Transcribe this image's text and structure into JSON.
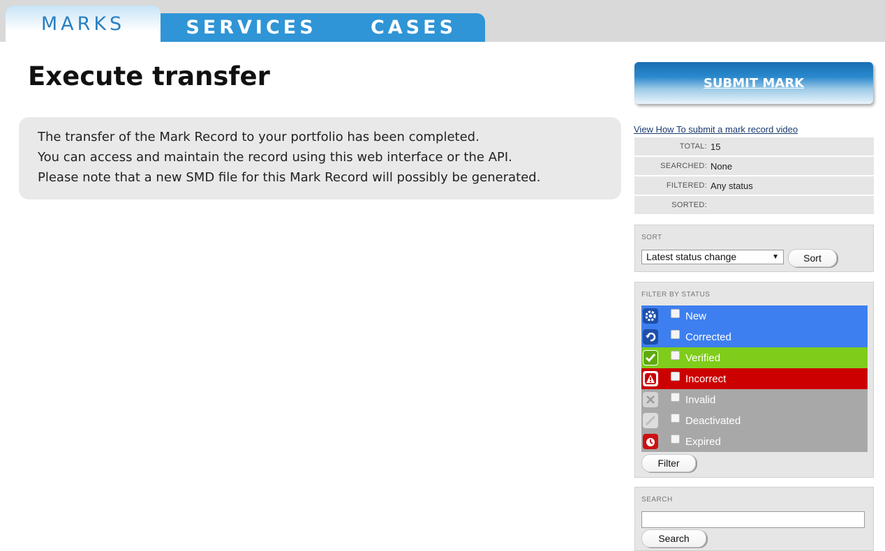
{
  "tabs": [
    {
      "label": "MARKS"
    },
    {
      "label": "SERVICES"
    },
    {
      "label": "CASES"
    }
  ],
  "page": {
    "title": "Execute transfer",
    "message_lines": [
      "The transfer of the Mark Record to your portfolio has been completed.",
      "You can access and maintain the record using this web interface or the API.",
      "Please note that a new SMD file for this Mark Record will possibly be generated."
    ]
  },
  "sidebar": {
    "submit_label": "SUBMIT MARK",
    "video_link": "View How To submit a mark record video",
    "stats": [
      {
        "label": "TOTAL:",
        "value": "15"
      },
      {
        "label": "SEARCHED:",
        "value": "None"
      },
      {
        "label": "FILTERED:",
        "value": "Any status"
      },
      {
        "label": "SORTED:",
        "value": ""
      }
    ],
    "sort": {
      "title": "SORT",
      "selected": "Latest status change",
      "button": "Sort"
    },
    "filter": {
      "title": "FILTER BY STATUS",
      "statuses": [
        {
          "label": "New",
          "color": "#3d7ff0",
          "icon": "gear-icon"
        },
        {
          "label": "Corrected",
          "color": "#3d7ff0",
          "icon": "undo-icon"
        },
        {
          "label": "Verified",
          "color": "#7fcc1a",
          "icon": "checkmark-icon"
        },
        {
          "label": "Incorrect",
          "color": "#cc0000",
          "icon": "warning-icon"
        },
        {
          "label": "Invalid",
          "color": "#a8a8a8",
          "icon": "cross-icon"
        },
        {
          "label": "Deactivated",
          "color": "#a8a8a8",
          "icon": "slash-icon"
        },
        {
          "label": "Expired",
          "color": "#a8a8a8",
          "icon": "clock-icon"
        }
      ],
      "button": "Filter"
    },
    "search": {
      "title": "SEARCH",
      "value": "",
      "button": "Search"
    }
  }
}
